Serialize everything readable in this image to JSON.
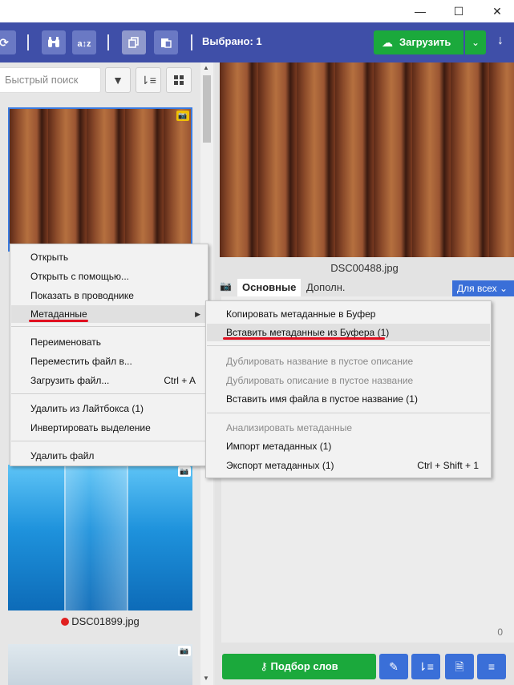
{
  "window": {
    "minimize_glyph": "—",
    "maximize_glyph": "☐",
    "close_glyph": "✕"
  },
  "toolbar": {
    "selected_label": "Выбрано: 1",
    "upload_label": "Загрузить",
    "icons": [
      "refresh-icon",
      "binoculars-icon",
      "sort-az-icon",
      "copy-icon",
      "paste-icon",
      "cloud-upload-icon",
      "chevron-down-icon",
      "arrow-down-icon"
    ],
    "colors": {
      "bar": "#3f4fa8",
      "upload": "#1ba93c"
    }
  },
  "left_panel": {
    "search_placeholder": "Быстрый поиск",
    "items": [
      {
        "filename": ""
      },
      {
        "filename": "DSC01899.jpg",
        "status_color": "#e02020"
      },
      {
        "filename": ""
      }
    ]
  },
  "preview": {
    "filename": "DSC00488.jpg"
  },
  "tabs": {
    "main_label": "Основные",
    "extra_label": "Дополн.",
    "for_all_label": "Для всех"
  },
  "meta": {
    "char_count": "0"
  },
  "bottom": {
    "keywords_label": "Подбор слов"
  },
  "context_menu": {
    "items": [
      {
        "label": "Открыть"
      },
      {
        "label": "Открыть с помощью..."
      },
      {
        "label": "Показать в проводнике"
      },
      {
        "label": "Метаданные"
      },
      {
        "label": "Переименовать"
      },
      {
        "label": "Переместить файл в..."
      },
      {
        "label": "Загрузить файл...",
        "shortcut": "Ctrl + A"
      },
      {
        "label": "Удалить из Лайтбокса (1)"
      },
      {
        "label": "Инвертировать выделение"
      },
      {
        "label": "Удалить файл"
      }
    ]
  },
  "submenu": {
    "items": [
      {
        "label": "Копировать метаданные в Буфер"
      },
      {
        "label": "Вставить метаданные из Буфера (1)"
      },
      {
        "label": "Дублировать название в пустое описание",
        "disabled": true
      },
      {
        "label": "Дублировать описание в пустое название",
        "disabled": true
      },
      {
        "label": "Вставить имя файла в пустое название (1)"
      },
      {
        "label": "Анализировать метаданные",
        "disabled": true
      },
      {
        "label": "Импорт метаданных (1)"
      },
      {
        "label": "Экспорт метаданных (1)",
        "shortcut": "Ctrl + Shift + 1"
      }
    ]
  }
}
